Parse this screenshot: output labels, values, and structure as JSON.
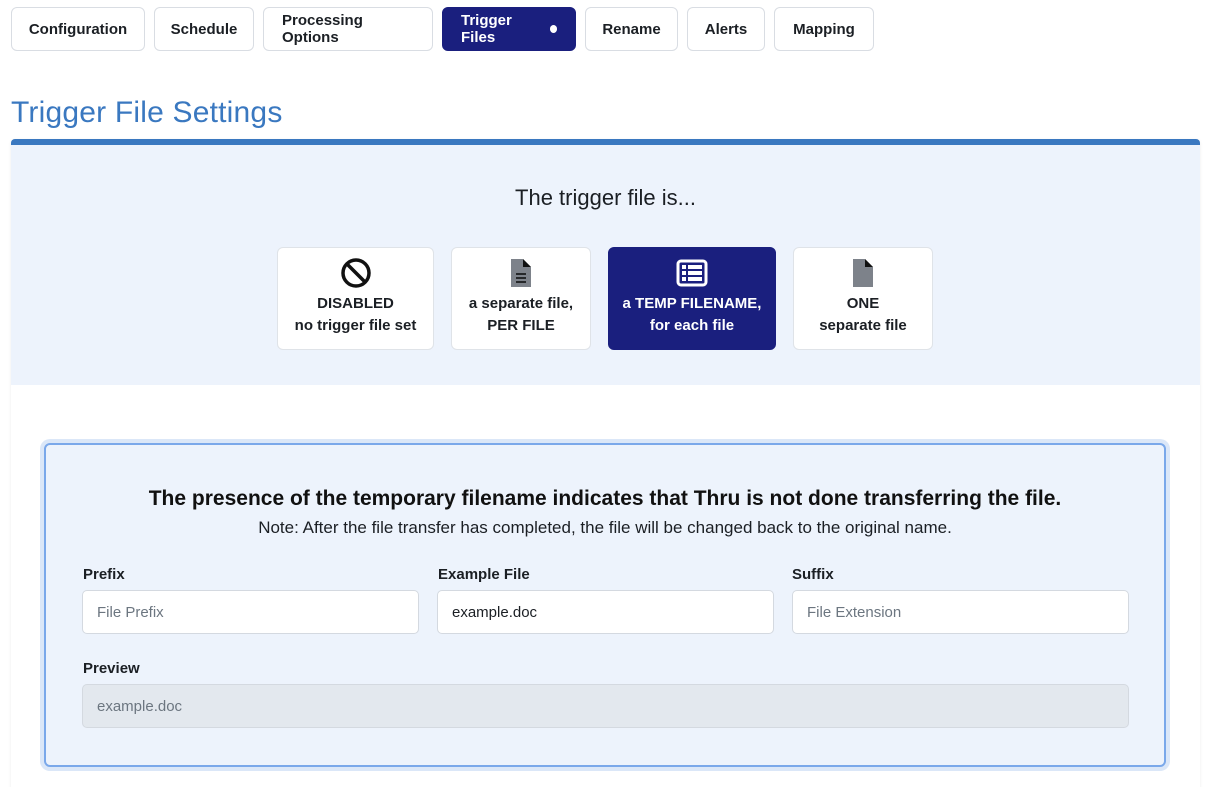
{
  "tabs": [
    {
      "label": "Configuration"
    },
    {
      "label": "Schedule"
    },
    {
      "label": "Processing Options"
    },
    {
      "label": "Trigger Files"
    },
    {
      "label": "Rename"
    },
    {
      "label": "Alerts"
    },
    {
      "label": "Mapping"
    }
  ],
  "active_tab": "Trigger Files",
  "section_title": "Trigger File Settings",
  "trigger": {
    "heading": "The trigger file is...",
    "options": [
      {
        "line1": "DISABLED",
        "line2": "no trigger file set",
        "icon": "ban-icon"
      },
      {
        "line1": "a separate file,",
        "line2": "PER FILE",
        "icon": "file-lines-icon"
      },
      {
        "line1": "a TEMP FILENAME,",
        "line2": "for each file",
        "icon": "list-table-icon",
        "selected": true
      },
      {
        "line1": "ONE",
        "line2": "separate file",
        "icon": "file-icon"
      }
    ]
  },
  "info": {
    "title": "The presence of the temporary filename indicates that Thru is not done transferring the file.",
    "note": "Note: After the file transfer has completed, the file will be changed back to the original name."
  },
  "form": {
    "prefix": {
      "label": "Prefix",
      "value": "",
      "placeholder": "File Prefix"
    },
    "example": {
      "label": "Example File",
      "value": "example.doc",
      "placeholder": ""
    },
    "suffix": {
      "label": "Suffix",
      "value": "",
      "placeholder": "File Extension"
    },
    "preview": {
      "label": "Preview",
      "value": "example.doc"
    }
  },
  "colors": {
    "accent": "#3a78c0",
    "active": "#1a1f7e",
    "panel_bg": "#edf3fc",
    "info_border": "#7aa8ea"
  }
}
